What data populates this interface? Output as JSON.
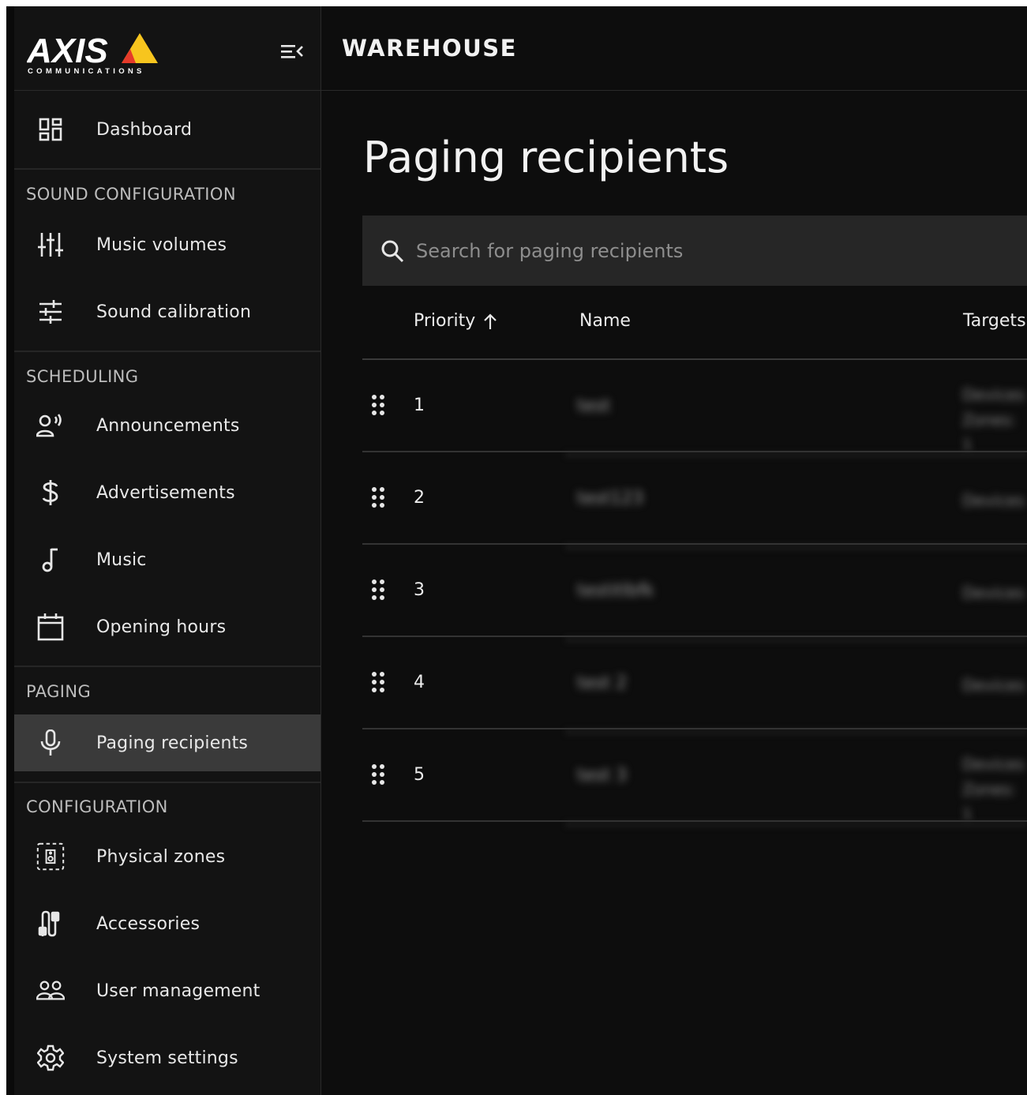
{
  "brand": {
    "logo_text": "AXIS",
    "logo_subtext": "COMMUNICATIONS",
    "accent": "#f7c51e",
    "accent_dark": "#e53a2a"
  },
  "header": {
    "site_name": "WAREHOUSE"
  },
  "sidebar": {
    "dashboard": {
      "label": "Dashboard",
      "icon": "dashboard-icon"
    },
    "sections": [
      {
        "title": "SOUND CONFIGURATION",
        "items": [
          {
            "label": "Music volumes",
            "icon": "sliders-vertical-icon"
          },
          {
            "label": "Sound calibration",
            "icon": "tune-icon"
          }
        ]
      },
      {
        "title": "SCHEDULING",
        "items": [
          {
            "label": "Announcements",
            "icon": "announcement-icon"
          },
          {
            "label": "Advertisements",
            "icon": "dollar-icon"
          },
          {
            "label": "Music",
            "icon": "music-note-icon"
          },
          {
            "label": "Opening hours",
            "icon": "calendar-icon"
          }
        ]
      },
      {
        "title": "PAGING",
        "items": [
          {
            "label": "Paging recipients",
            "icon": "microphone-icon",
            "active": true
          }
        ]
      },
      {
        "title": "CONFIGURATION",
        "items": [
          {
            "label": "Physical zones",
            "icon": "speaker-zone-icon"
          },
          {
            "label": "Accessories",
            "icon": "accessories-icon"
          },
          {
            "label": "User management",
            "icon": "users-icon"
          },
          {
            "label": "System settings",
            "icon": "gear-icon"
          }
        ]
      }
    ]
  },
  "main": {
    "title": "Paging recipients",
    "search_placeholder": "Search for paging recipients",
    "columns": {
      "priority": "Priority",
      "name": "Name",
      "targets": "Targets"
    },
    "rows": [
      {
        "priority": "1",
        "name": "test",
        "targets": [
          "Devices",
          "Zones: 1"
        ]
      },
      {
        "priority": "2",
        "name": "test123",
        "targets": [
          "Devices"
        ]
      },
      {
        "priority": "3",
        "name": "testitlbfk",
        "targets": [
          "Devices"
        ]
      },
      {
        "priority": "4",
        "name": "test 2",
        "targets": [
          "Devices"
        ]
      },
      {
        "priority": "5",
        "name": "test 3",
        "targets": [
          "Devices",
          "Zones: 1"
        ]
      }
    ]
  }
}
